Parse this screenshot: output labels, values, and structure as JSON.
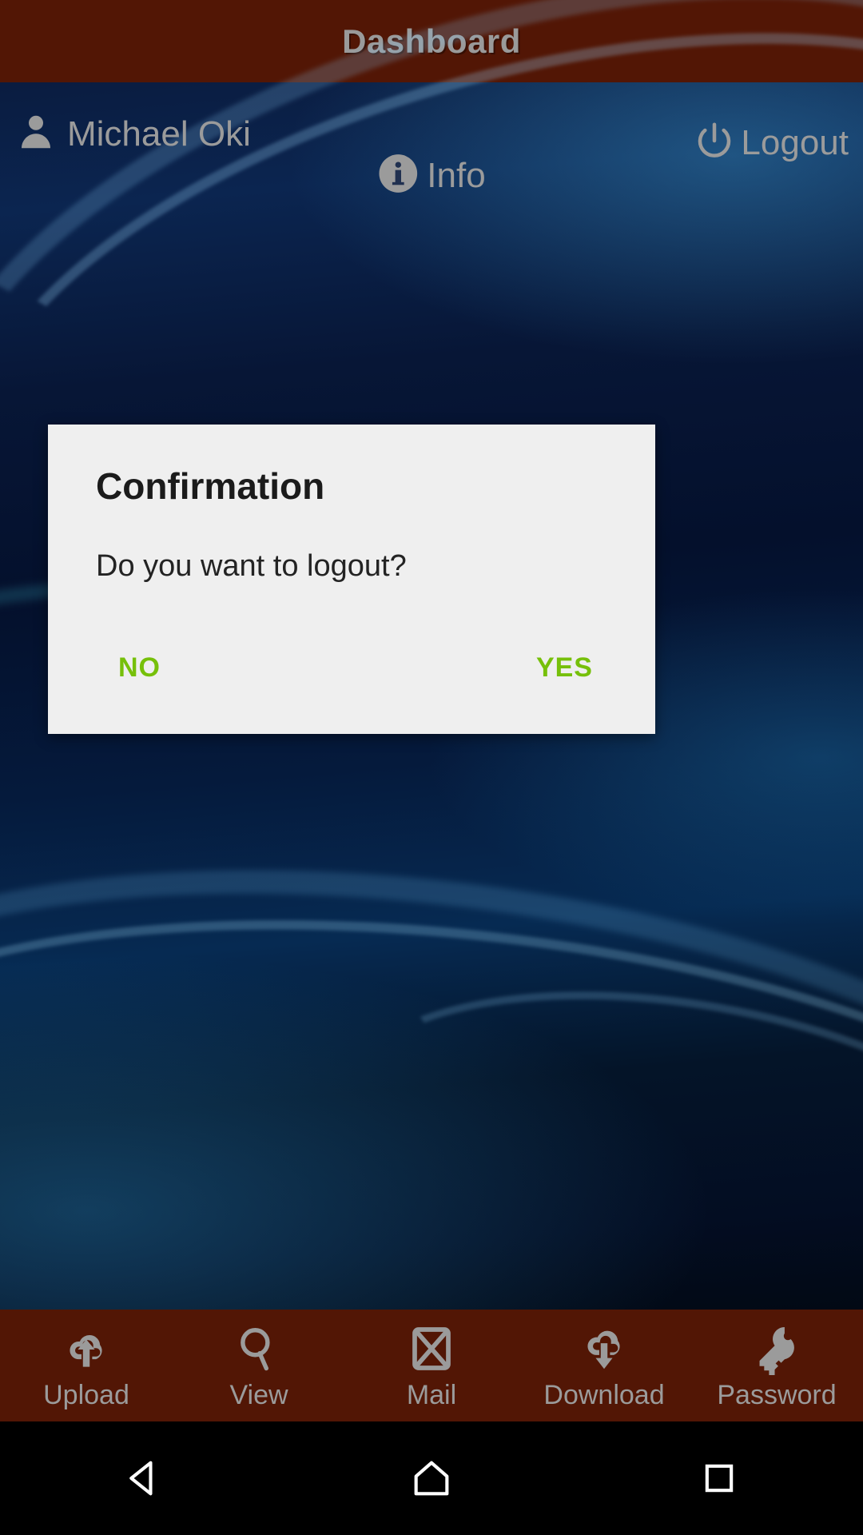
{
  "app": {
    "title": "Dashboard",
    "title_bar_color": "#521605",
    "title_text_color": "#9a9a9a"
  },
  "header": {
    "user": {
      "icon": "person-icon",
      "name": "Michael Oki"
    },
    "info": {
      "icon": "info-circle-icon",
      "label": "Info"
    },
    "logout": {
      "icon": "power-icon",
      "label": "Logout"
    },
    "text_color": "#9b9b9b"
  },
  "dialog": {
    "title": "Confirmation",
    "message": "Do you want to logout?",
    "background": "#efefef",
    "title_color": "#1b1b1b",
    "message_color": "#232323",
    "button_color": "#76c00a",
    "buttons": [
      {
        "label": "NO",
        "name": "no-button"
      },
      {
        "label": "YES",
        "name": "yes-button"
      }
    ]
  },
  "tabbar": {
    "background": "#521605",
    "label_color": "#9b9b9b",
    "items": [
      {
        "label": "Upload",
        "icon": "cloud-upload-icon"
      },
      {
        "label": "View",
        "icon": "magnifier-icon"
      },
      {
        "label": "Mail",
        "icon": "envelope-icon"
      },
      {
        "label": "Download",
        "icon": "cloud-download-icon"
      },
      {
        "label": "Password",
        "icon": "key-icon"
      }
    ]
  },
  "navbar": {
    "background": "#000000",
    "items": [
      {
        "name": "back-button",
        "icon": "triangle-back-icon"
      },
      {
        "name": "home-button",
        "icon": "home-icon"
      },
      {
        "name": "recents-button",
        "icon": "square-recents-icon"
      }
    ]
  }
}
